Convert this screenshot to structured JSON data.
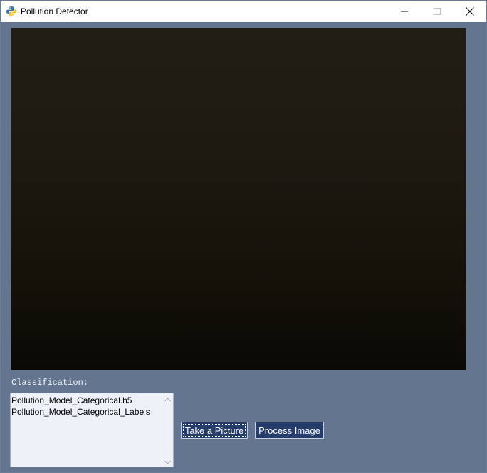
{
  "window": {
    "title": "Pollution Detector",
    "icon": "python-icon",
    "controls": [
      "minimize-icon",
      "maximize-icon",
      "close-icon"
    ]
  },
  "classification": {
    "label": "Classification:",
    "items": [
      "Pollution_Model_Categorical.h5",
      "Pollution_Model_Categorical_Labels"
    ]
  },
  "buttons": {
    "take_picture": "Take a Picture",
    "process_image": "Process Image"
  },
  "colors": {
    "window_bg": "#64758f",
    "button_bg": "#263c6b",
    "list_bg": "#eef1f8"
  }
}
